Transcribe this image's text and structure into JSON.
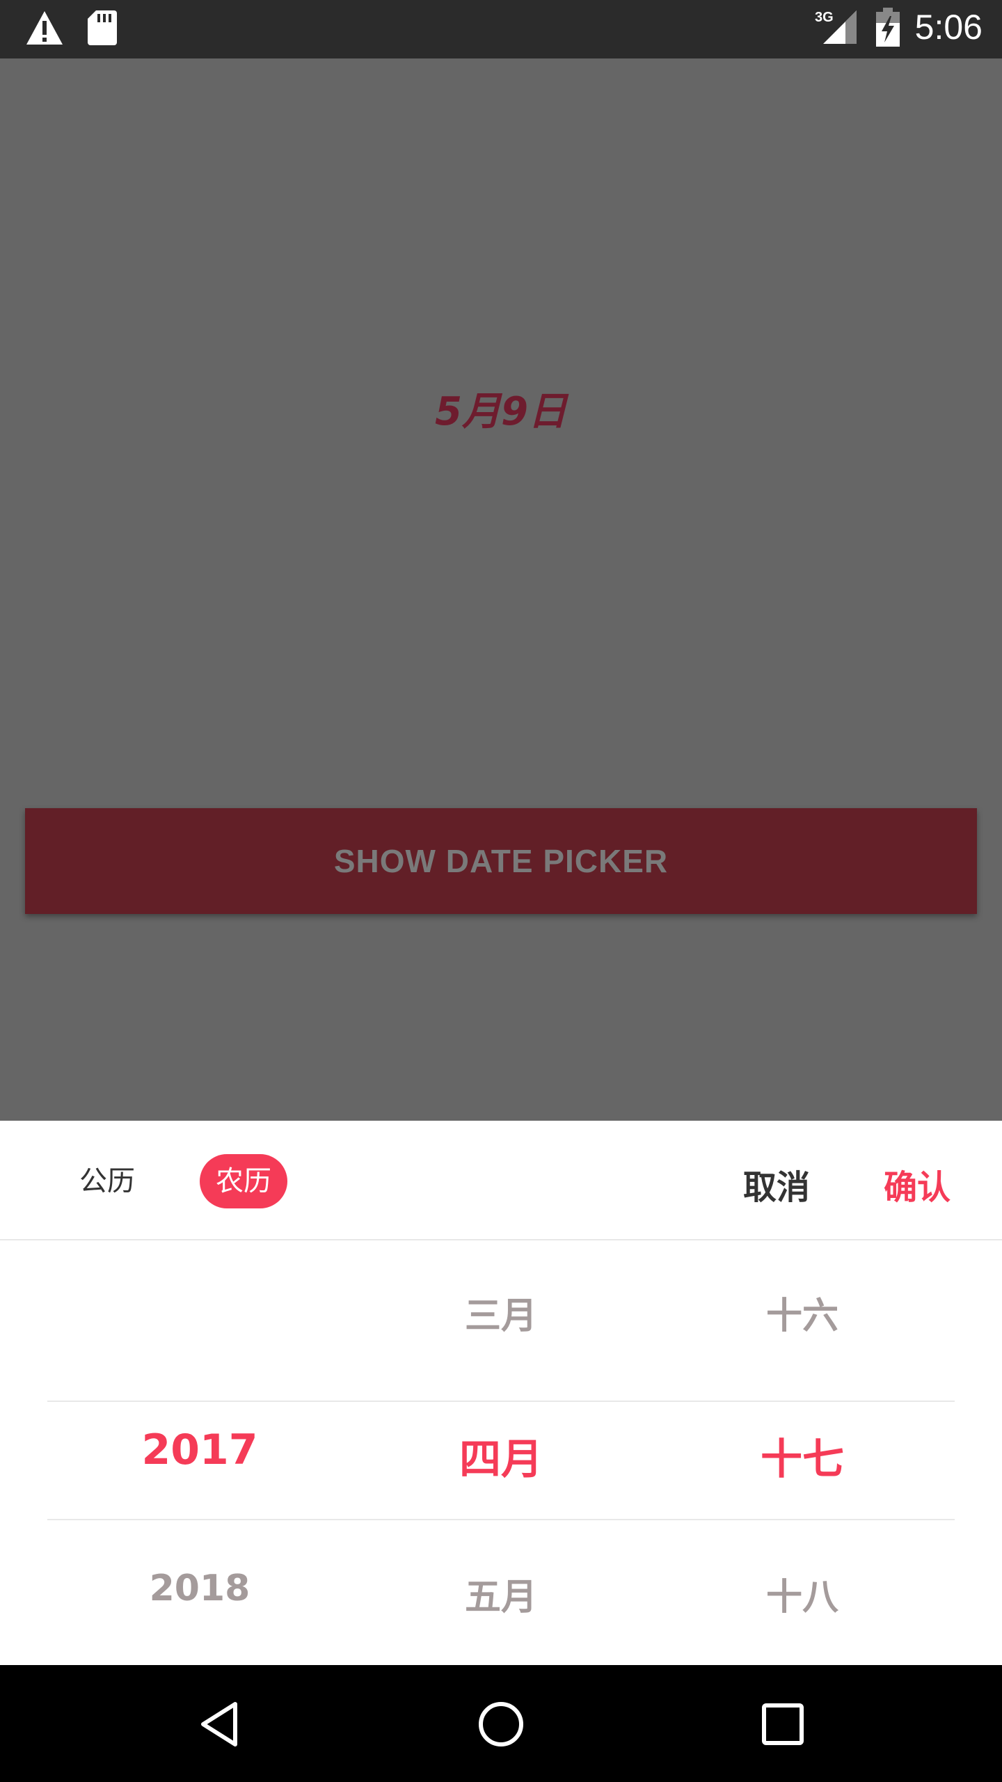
{
  "status_bar": {
    "time": "5:06",
    "network": "3G",
    "icons": [
      "warning-icon",
      "sd-card-icon",
      "signal-icon",
      "battery-charging-icon"
    ]
  },
  "main": {
    "date_display": "5月9日",
    "show_button_label": "SHOW DATE PICKER"
  },
  "picker": {
    "tabs": {
      "solar": "公历",
      "lunar": "农历",
      "active": "lunar"
    },
    "cancel_label": "取消",
    "confirm_label": "确认",
    "year_column": {
      "prev": "",
      "selected": "2017",
      "next": "2018"
    },
    "month_column": {
      "prev": "三月",
      "selected": "四月",
      "next": "五月"
    },
    "day_column": {
      "prev": "十六",
      "selected": "十七",
      "next": "十八"
    }
  },
  "colors": {
    "accent": "#f53b57",
    "dim_overlay": "#666666",
    "button_bg": "#621f27"
  },
  "nav_bar": {
    "icons": [
      "back-icon",
      "home-icon",
      "recents-icon"
    ]
  }
}
